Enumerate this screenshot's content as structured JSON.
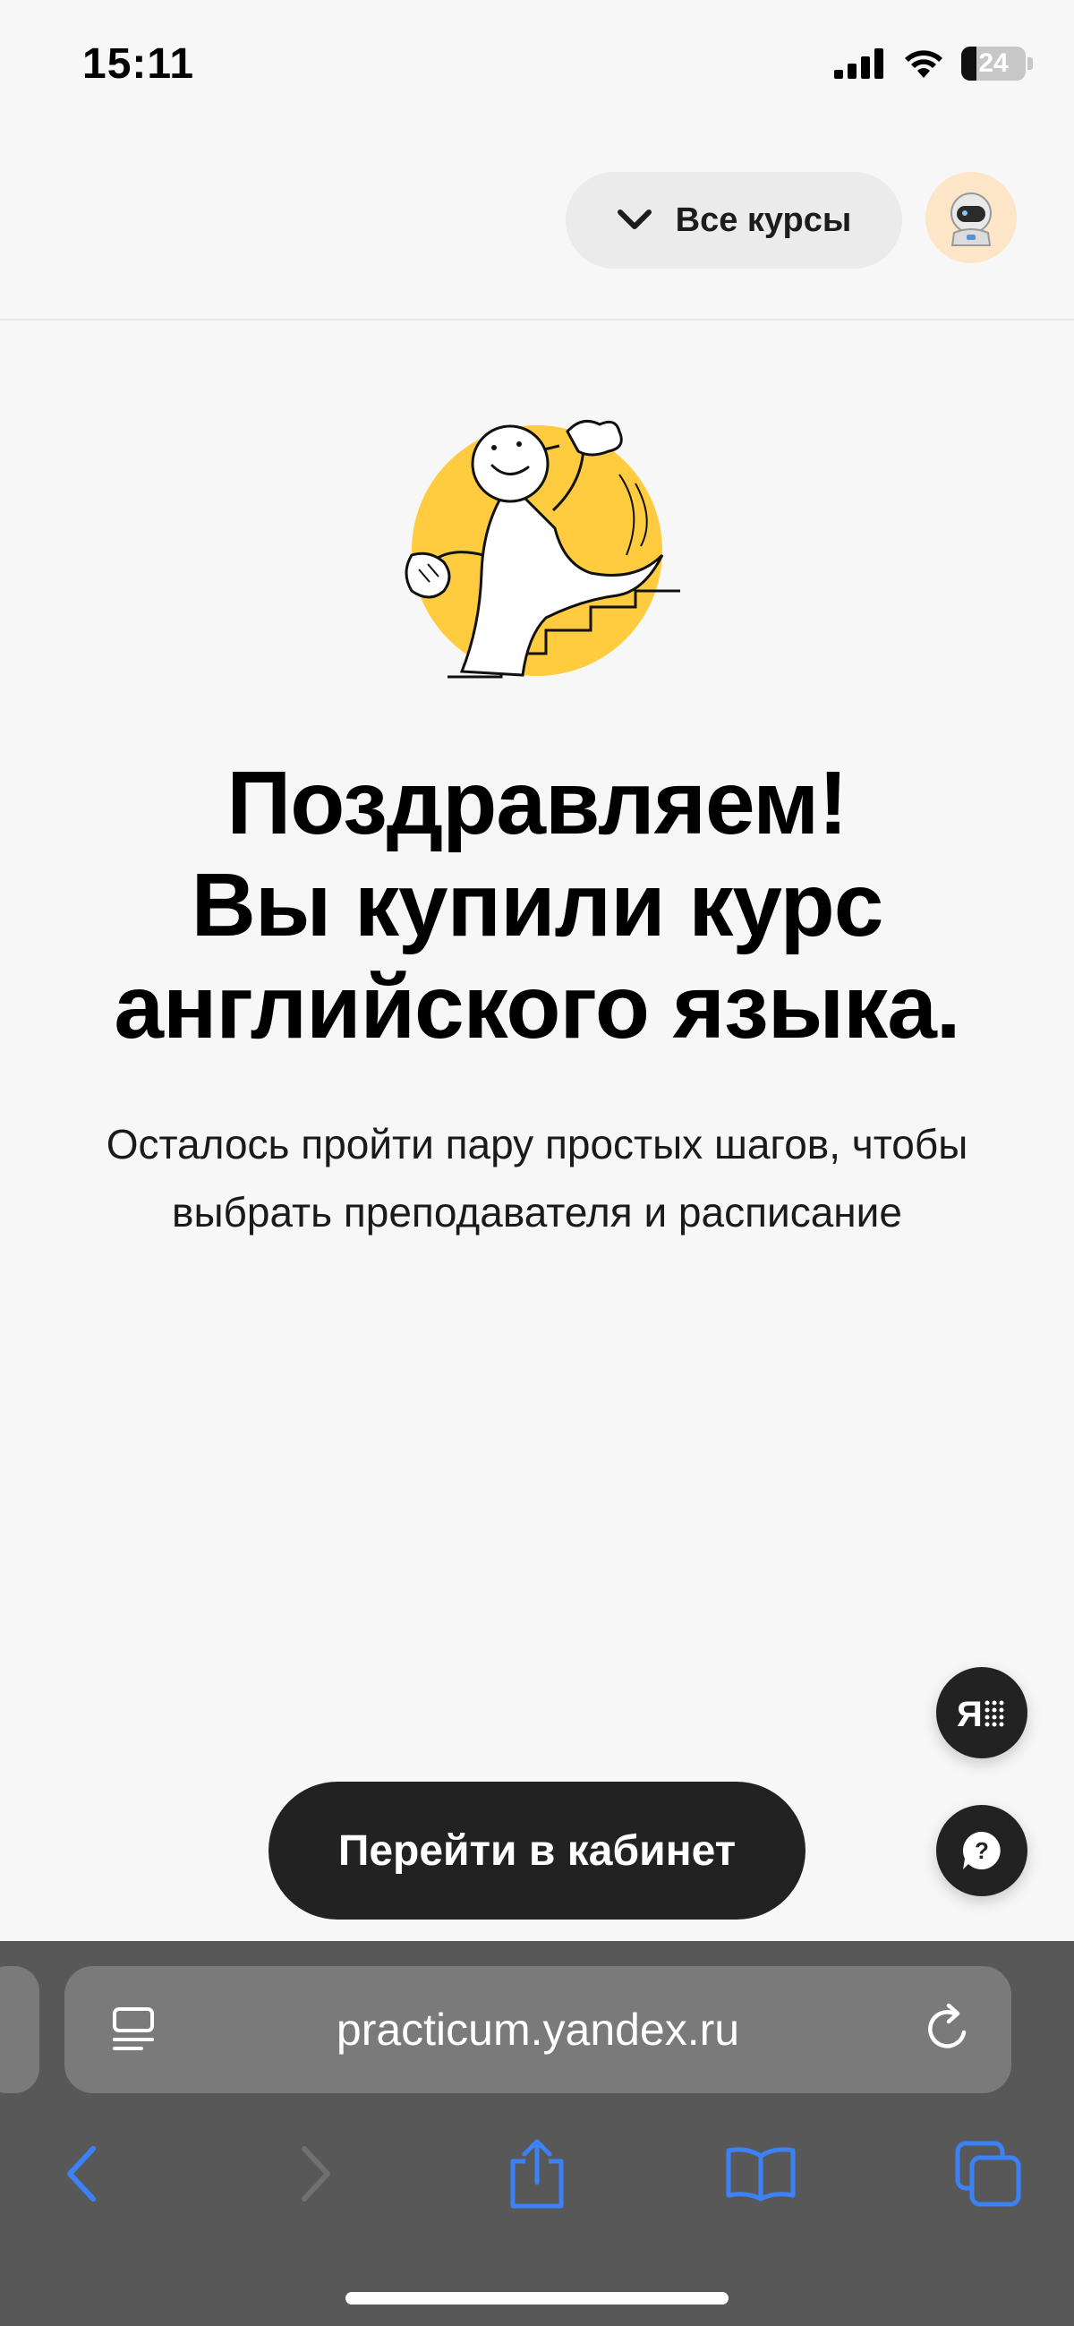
{
  "status_bar": {
    "time": "15:11",
    "battery_level": "24",
    "battery_fraction": 0.24
  },
  "header": {
    "courses_button_label": "Все курсы"
  },
  "main": {
    "title_lines": [
      "Поздравляем!",
      "Вы купили курс",
      "английского языка."
    ],
    "subtitle_lines": [
      "Осталось пройти пару простых шагов, чтобы",
      "выбрать преподавателя и расписание"
    ],
    "cta_label": "Перейти в кабинет"
  },
  "browser": {
    "url": "practicum.yandex.ru"
  },
  "colors": {
    "accent_yellow": "#fecc3e",
    "dark_button": "#222222",
    "ios_blue": "#3b82f6",
    "background": "#f7f7f7"
  },
  "icons": [
    "signal-icon",
    "wifi-icon",
    "battery-icon",
    "chevron-down-icon",
    "astronaut-avatar-icon",
    "alice-icon",
    "help-icon",
    "reader-icon",
    "reload-icon",
    "back-icon",
    "forward-icon",
    "share-icon",
    "bookmarks-icon",
    "tabs-icon"
  ]
}
